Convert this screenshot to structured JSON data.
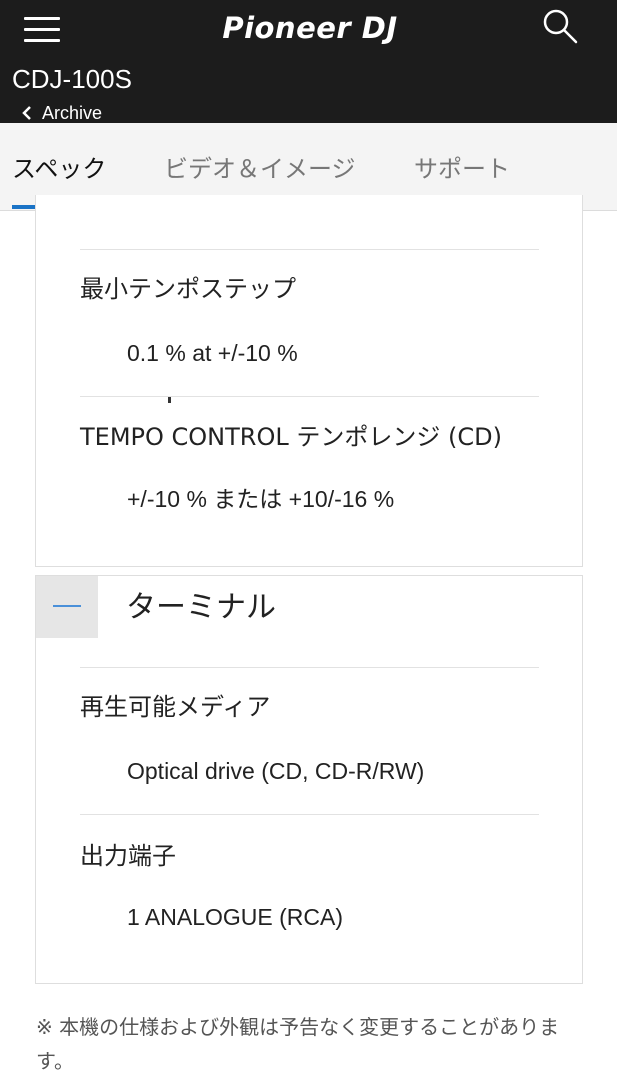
{
  "header": {
    "logo_text": "Pioneer DJ",
    "model": "CDJ-100S",
    "back_label": "Archive"
  },
  "tabs": [
    {
      "label": "スペック",
      "active": true
    },
    {
      "label": "ビデオ＆イメージ",
      "active": false
    },
    {
      "label": "サポート",
      "active": false
    }
  ],
  "sections": {
    "previous": {
      "specs": [
        {
          "label": "最小テンポステップ",
          "value": "0.1 % at +/-10 %"
        },
        {
          "label": "TEMPO CONTROL テンポレンジ (CD)",
          "value": "+/-10 % または +10/-16 %"
        }
      ]
    },
    "terminal": {
      "title": "ターミナル",
      "specs": [
        {
          "label": "再生可能メディア",
          "value": "Optical drive (CD, CD-R/RW)"
        },
        {
          "label": "出力端子",
          "value": "1 ANALOGUE (RCA)"
        }
      ]
    }
  },
  "footnote": "※ 本機の仕様および外観は予告なく変更することがあります。",
  "colors": {
    "header_bg": "#1c1c1c",
    "tab_accent": "#1a73c6",
    "collapse_minus": "#4a90d9"
  },
  "icons": {
    "menu": "hamburger-icon",
    "search": "search-icon",
    "back": "chevron-left-icon",
    "collapse": "minus-icon"
  }
}
